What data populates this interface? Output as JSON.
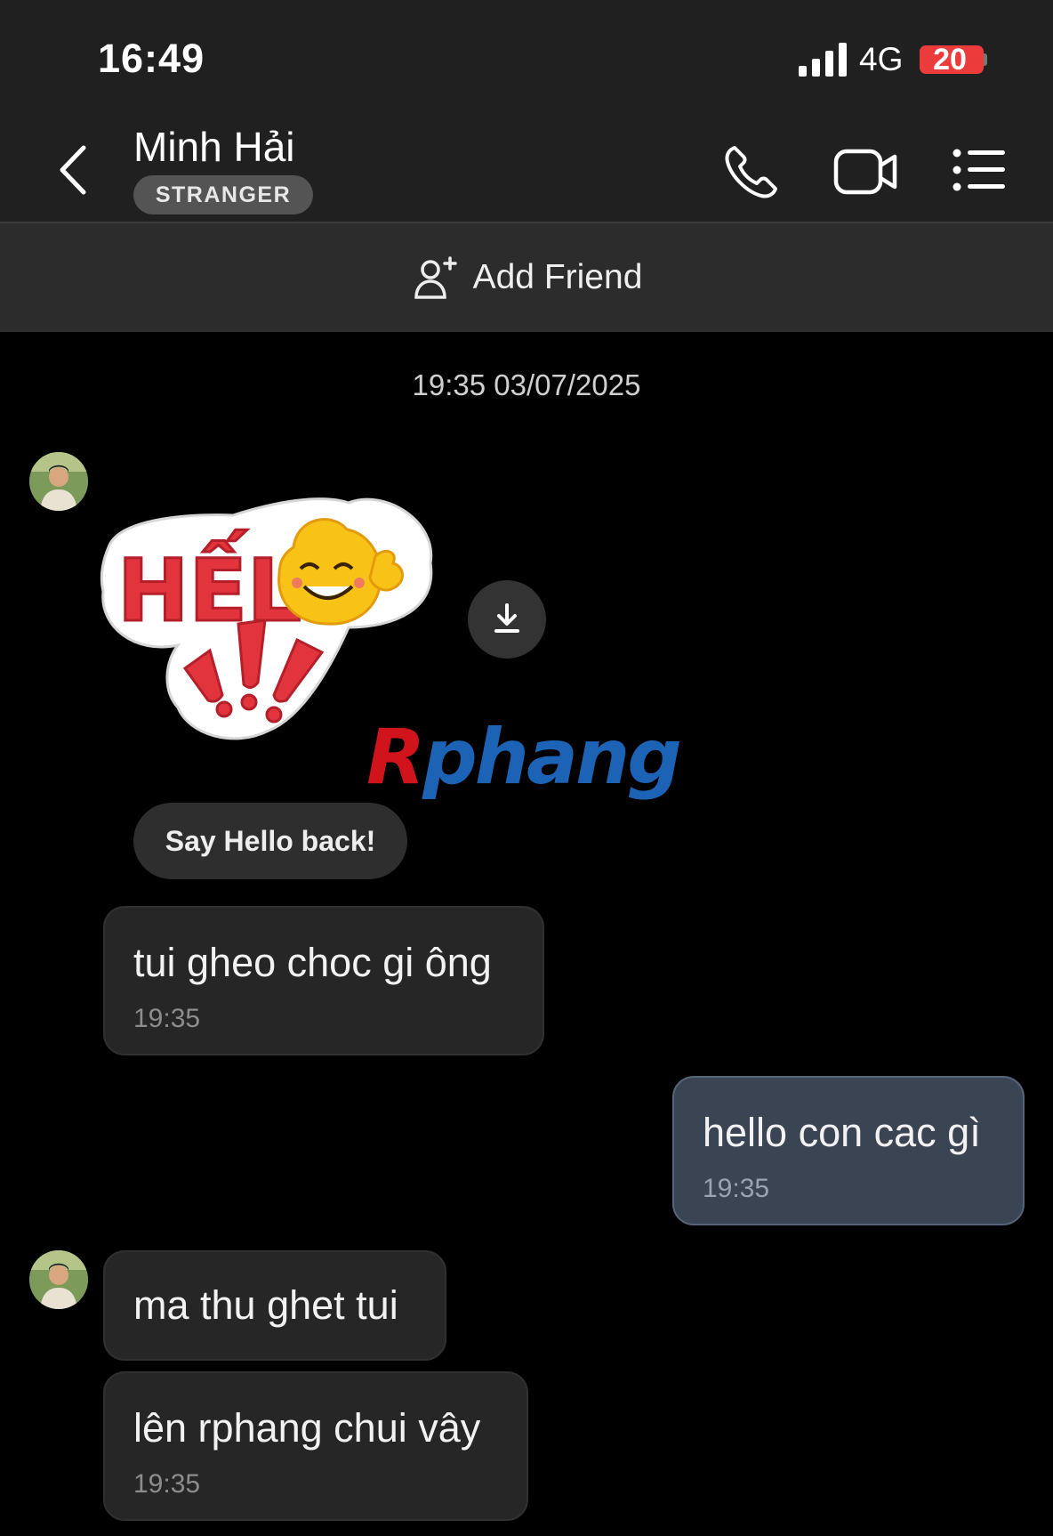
{
  "status_bar": {
    "time": "16:49",
    "network": "4G",
    "battery": "20"
  },
  "header": {
    "contact_name": "Minh Hải",
    "badge": "STRANGER",
    "icons": [
      "chevron-left-icon",
      "phone-icon",
      "video-camera-icon",
      "list-menu-icon"
    ]
  },
  "add_friend": {
    "label": "Add Friend",
    "icon": "add-user-icon"
  },
  "chat": {
    "date_stamp": "19:35 03/07/2025",
    "sticker_text": "HẾLÔ !!!",
    "quick_reply": "Say Hello back!",
    "watermark": {
      "first": "R",
      "rest": "phang"
    },
    "messages": [
      {
        "text": "tui gheo choc gi ông",
        "time": "19:35",
        "sender": "them"
      },
      {
        "text": "hello con cac gì",
        "time": "19:35",
        "sender": "me"
      },
      {
        "text": "ma thu ghet tui",
        "time": "",
        "sender": "them"
      },
      {
        "text": "lên rphang chui vây",
        "time": "19:35",
        "sender": "them"
      }
    ]
  },
  "colors": {
    "background": "#000000",
    "header": "#202020",
    "bubble_them": "#262626",
    "bubble_me": "#3a4452",
    "battery_low": "#ec3b3b"
  }
}
